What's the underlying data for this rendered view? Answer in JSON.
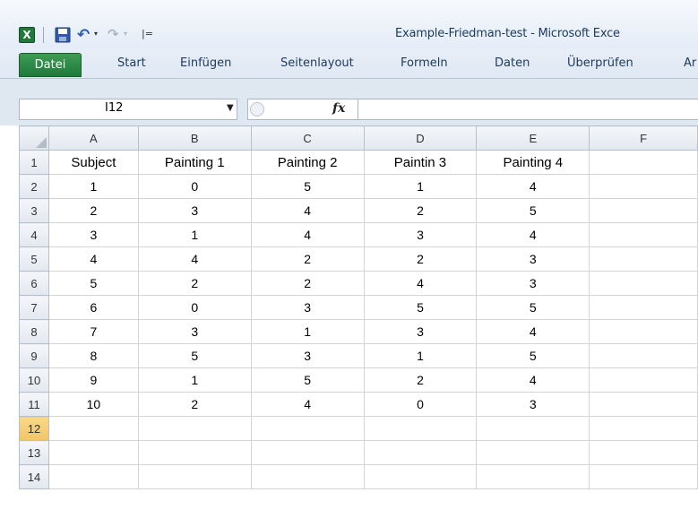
{
  "window": {
    "title": "Example-Friedman-test - Microsoft Exce"
  },
  "quick_access": {
    "app_icon": "excel-icon",
    "save_icon": "save-icon",
    "undo_icon": "undo-icon",
    "redo_icon": "redo-icon",
    "customize_icon": "customize-icon",
    "app_glyph": "X",
    "undo_glyph": "↶",
    "redo_glyph": "↷",
    "dropdown_glyph": "▾",
    "customize_glyph": "|="
  },
  "ribbon": {
    "tabs": [
      {
        "label": "Datei"
      },
      {
        "label": "Start"
      },
      {
        "label": "Einfügen"
      },
      {
        "label": "Seitenlayout"
      },
      {
        "label": "Formeln"
      },
      {
        "label": "Daten"
      },
      {
        "label": "Überprüfen"
      },
      {
        "label": "Ar"
      }
    ]
  },
  "formula_bar": {
    "name_box_value": "I12",
    "name_box_dropdown": "▼",
    "fx_label": "fx",
    "formula_value": ""
  },
  "sheet": {
    "columns": [
      "A",
      "B",
      "C",
      "D",
      "E",
      "F"
    ],
    "active_row": "12",
    "rows": [
      {
        "num": "1",
        "cells": [
          "Subject",
          "Painting 1",
          "Painting 2",
          "Paintin 3",
          "Painting 4",
          ""
        ]
      },
      {
        "num": "2",
        "cells": [
          "1",
          "0",
          "5",
          "1",
          "4",
          ""
        ]
      },
      {
        "num": "3",
        "cells": [
          "2",
          "3",
          "4",
          "2",
          "5",
          ""
        ]
      },
      {
        "num": "4",
        "cells": [
          "3",
          "1",
          "4",
          "3",
          "4",
          ""
        ]
      },
      {
        "num": "5",
        "cells": [
          "4",
          "4",
          "2",
          "2",
          "3",
          ""
        ]
      },
      {
        "num": "6",
        "cells": [
          "5",
          "2",
          "2",
          "4",
          "3",
          ""
        ]
      },
      {
        "num": "7",
        "cells": [
          "6",
          "0",
          "3",
          "5",
          "5",
          ""
        ]
      },
      {
        "num": "8",
        "cells": [
          "7",
          "3",
          "1",
          "3",
          "4",
          ""
        ]
      },
      {
        "num": "9",
        "cells": [
          "8",
          "5",
          "3",
          "1",
          "5",
          ""
        ]
      },
      {
        "num": "10",
        "cells": [
          "9",
          "1",
          "5",
          "2",
          "4",
          ""
        ]
      },
      {
        "num": "11",
        "cells": [
          "10",
          "2",
          "4",
          "0",
          "3",
          ""
        ]
      },
      {
        "num": "12",
        "cells": [
          "",
          "",
          "",
          "",
          "",
          ""
        ]
      },
      {
        "num": "13",
        "cells": [
          "",
          "",
          "",
          "",
          "",
          ""
        ]
      },
      {
        "num": "14",
        "cells": [
          "",
          "",
          "",
          "",
          "",
          ""
        ]
      }
    ]
  },
  "colors": {
    "accent": "#1f7a3a",
    "active_row_header": "#f2c466",
    "grid_line": "#d4d4d4"
  }
}
